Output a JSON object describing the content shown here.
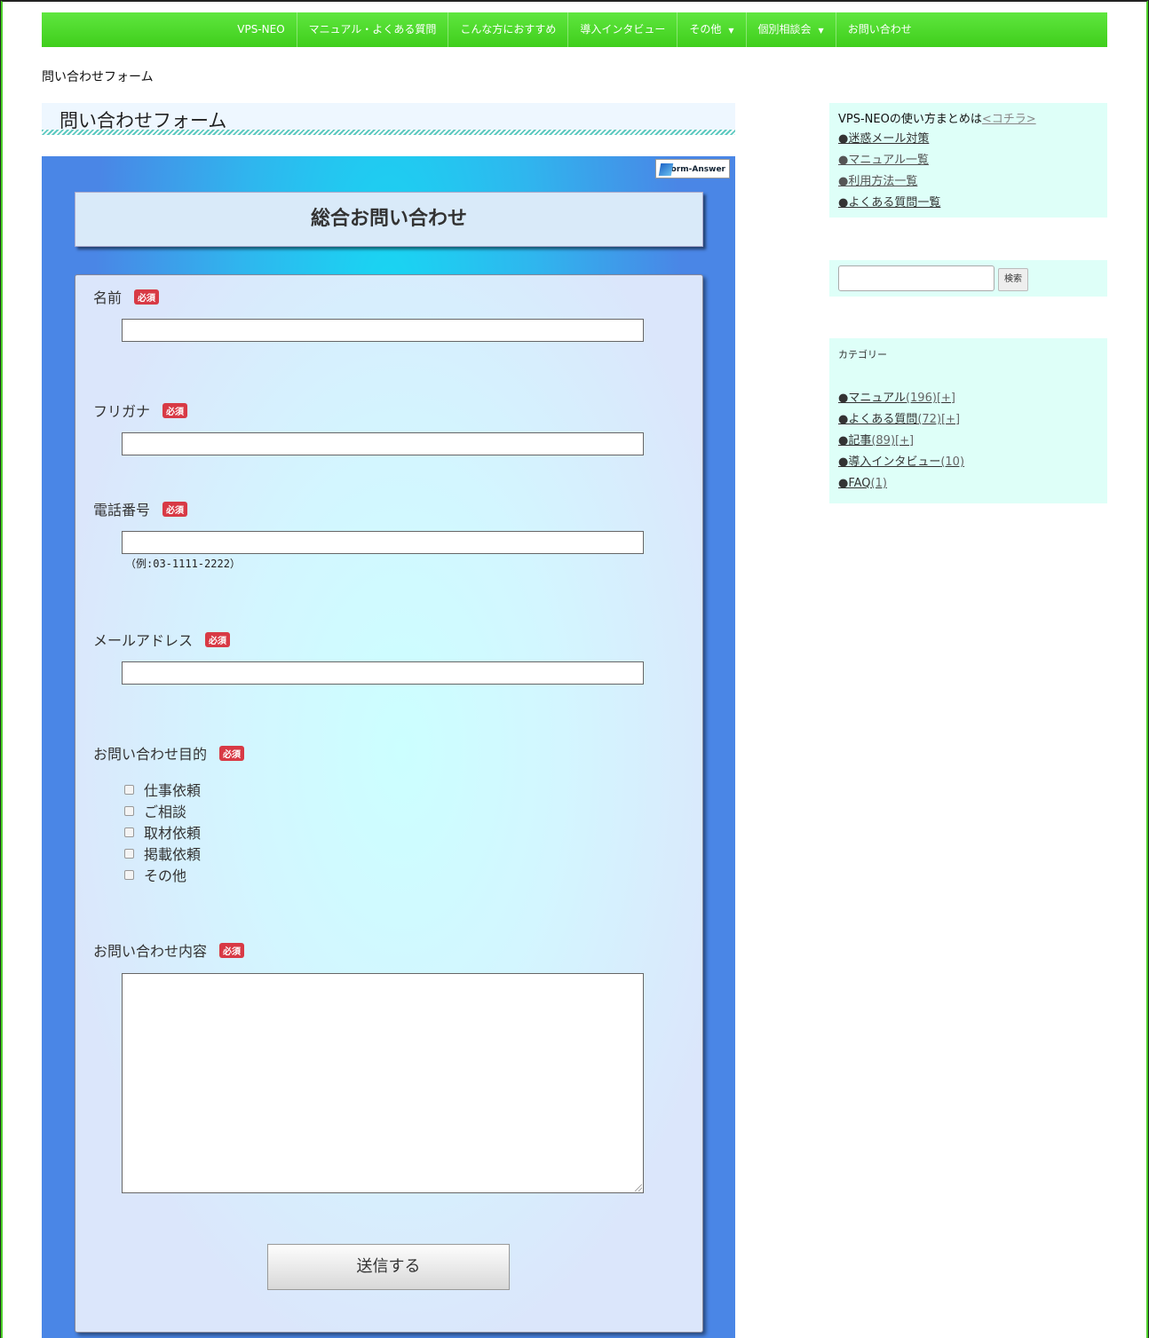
{
  "nav": {
    "items": [
      {
        "label": "VPS-NEO",
        "dropdown": false
      },
      {
        "label": "マニュアル・よくある質問",
        "dropdown": false
      },
      {
        "label": "こんな方におすすめ",
        "dropdown": false
      },
      {
        "label": "導入インタビュー",
        "dropdown": false
      },
      {
        "label": "その他",
        "dropdown": true
      },
      {
        "label": "個別相談会",
        "dropdown": true
      },
      {
        "label": "お問い合わせ",
        "dropdown": false
      }
    ],
    "caret": "▼"
  },
  "breadcrumb": "問い合わせフォーム",
  "page_title": "問い合わせフォーム",
  "form": {
    "badge": "Form-Answer",
    "header": "総合お問い合わせ",
    "required_label": "必須",
    "fields": {
      "name": {
        "label": "名前",
        "value": ""
      },
      "furigana": {
        "label": "フリガナ",
        "value": ""
      },
      "phone": {
        "label": "電話番号",
        "value": "",
        "hint": "（例:03-1111-2222）"
      },
      "email": {
        "label": "メールアドレス",
        "value": ""
      },
      "purpose": {
        "label": "お問い合わせ目的",
        "options": [
          "仕事依頼",
          "ご相談",
          "取材依頼",
          "掲載依頼",
          "その他"
        ]
      },
      "content": {
        "label": "お問い合わせ内容",
        "value": ""
      }
    },
    "submit_label": "送信する"
  },
  "sidebar": {
    "guide": {
      "intro": "VPS-NEOの使い方まとめは",
      "intro_link": "<コチラ>",
      "links": [
        "●迷惑メール対策",
        "●マニュアル一覧",
        "●利用方法一覧",
        "●よくある質問一覧"
      ]
    },
    "search": {
      "button": "検索",
      "value": ""
    },
    "categories": {
      "title": "カテゴリー",
      "items": [
        {
          "label": "●マニュアル",
          "count": "(196)",
          "expand": "[+]"
        },
        {
          "label": "●よくある質問",
          "count": "(72)",
          "expand": "[+]"
        },
        {
          "label": "●記事",
          "count": "(89)",
          "expand": "[+]"
        },
        {
          "label": "●導入インタビュー",
          "count": "(10)",
          "expand": ""
        },
        {
          "label": "●FAQ",
          "count": "(1)",
          "expand": ""
        }
      ]
    }
  }
}
